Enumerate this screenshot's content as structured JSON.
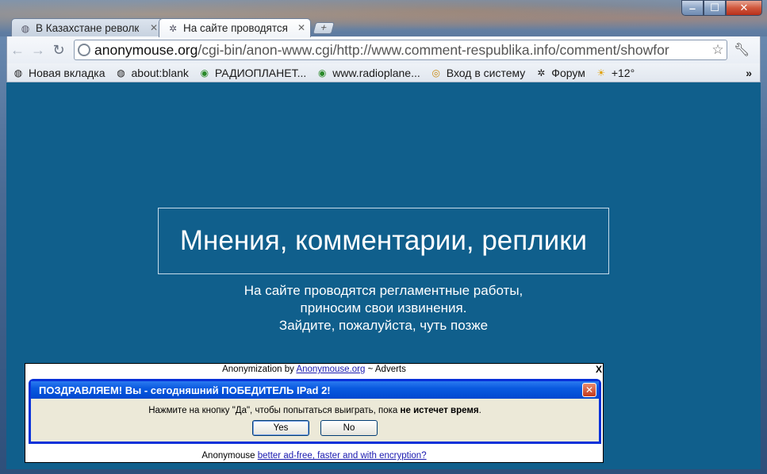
{
  "window": {
    "controls": {
      "minimize": "‒",
      "maximize": "☐",
      "close": "✕"
    }
  },
  "tabs": [
    {
      "title": "В Казахстане револк",
      "icon": "globe-icon",
      "active": false
    },
    {
      "title": "На сайте проводятся",
      "icon": "site-icon",
      "active": true
    }
  ],
  "new_tab_label": "+",
  "toolbar": {
    "url_domain": "anonymouse.org",
    "url_path": "/cgi-bin/anon-www.cgi/http://www.comment-respublika.info/comment/showfor"
  },
  "bookmarks": [
    {
      "label": "Новая вкладка",
      "icon": "globe-icon"
    },
    {
      "label": "about:blank",
      "icon": "globe-icon"
    },
    {
      "label": "РАДИОПЛАНЕТ...",
      "icon": "radio-icon"
    },
    {
      "label": "www.radioplane...",
      "icon": "radio-icon"
    },
    {
      "label": "Вход в систему",
      "icon": "login-icon"
    },
    {
      "label": "Форум",
      "icon": "forum-icon"
    },
    {
      "label": "+12°",
      "icon": "weather-icon"
    }
  ],
  "bookmarks_more": "»",
  "page": {
    "title": "Мнения, комментарии, реплики",
    "notice_line1": "На сайте проводятся регламентные работы,",
    "notice_line2": "приносим свои извинения.",
    "notice_line3": "Зайдите, пожалуйста, чуть позже"
  },
  "ad": {
    "header_prefix": "Anonymization by ",
    "header_link": "Anonymouse.org",
    "header_suffix": " ~ Adverts",
    "close_label": "X",
    "dialog_title": "ПОЗДРАВЛЯЕМ! Вы - сегодняшний ПОБЕДИТЕЛЬ IPad 2!",
    "dialog_close": "✕",
    "message_prefix": "Нажмите на кнопку \"Да\", чтобы попытаться выиграть, пока ",
    "message_bold": "не истечет время",
    "message_suffix": ".",
    "yes_label": "Yes",
    "no_label": "No",
    "footer_prefix": "Anonymouse ",
    "footer_link": "better ad-free, faster and with encryption?"
  }
}
